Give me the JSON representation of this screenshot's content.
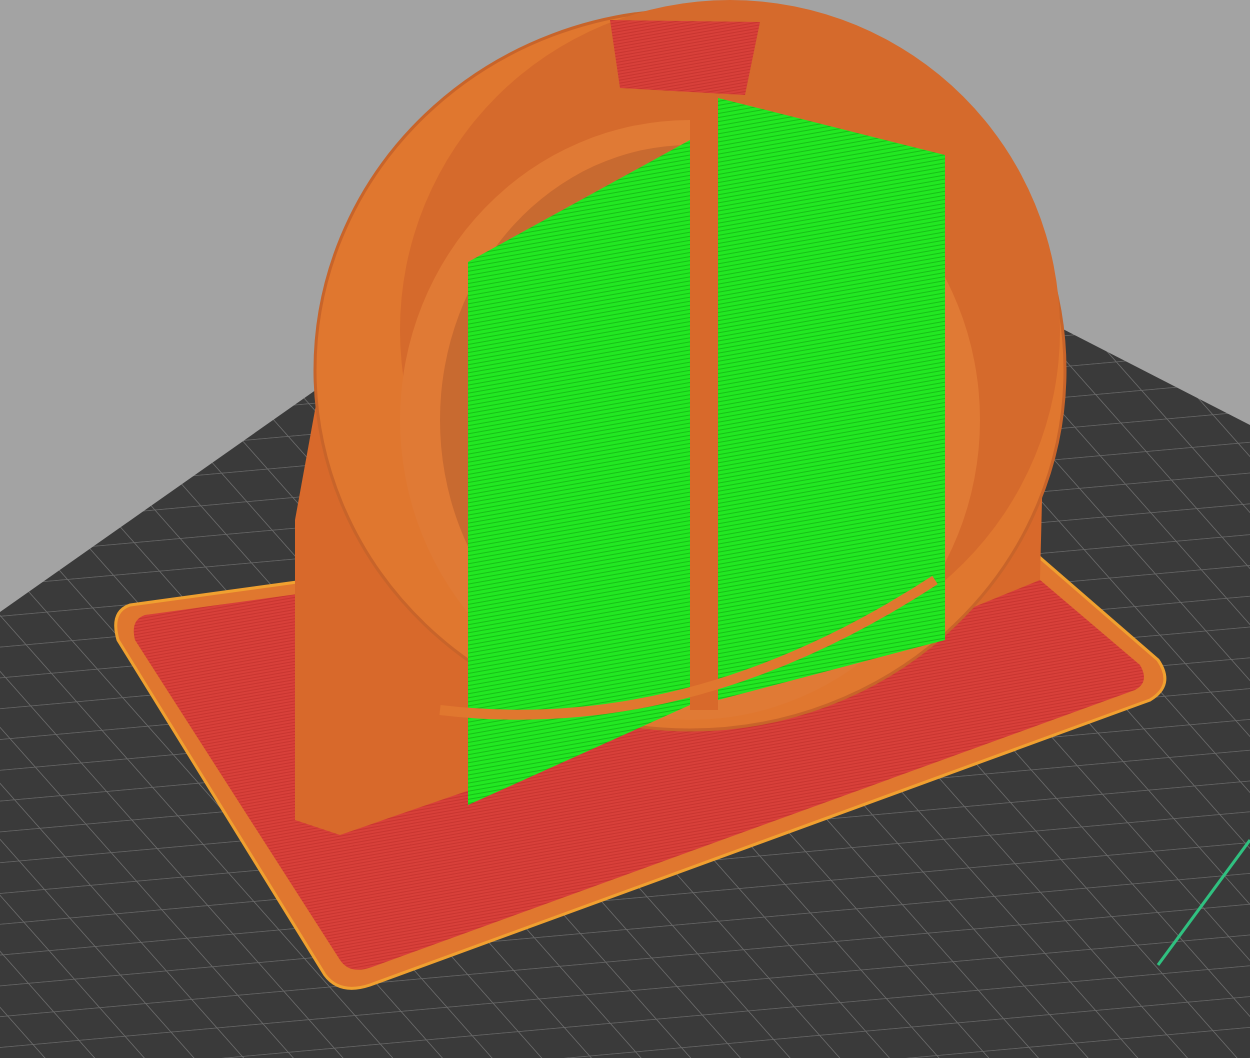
{
  "viewport": {
    "view": "3d-preview",
    "colors": {
      "background": "#a3a3a3",
      "bed": "#3a3a3a",
      "bed_grid": "#6a6a6a",
      "perimeter": "#e0772f",
      "perimeter_dark": "#c8642a",
      "external_perimeter": "#f0a030",
      "solid_infill": "#d8403a",
      "support": "#22e822",
      "support_dark": "#18b818",
      "axis": "#30c080"
    }
  }
}
